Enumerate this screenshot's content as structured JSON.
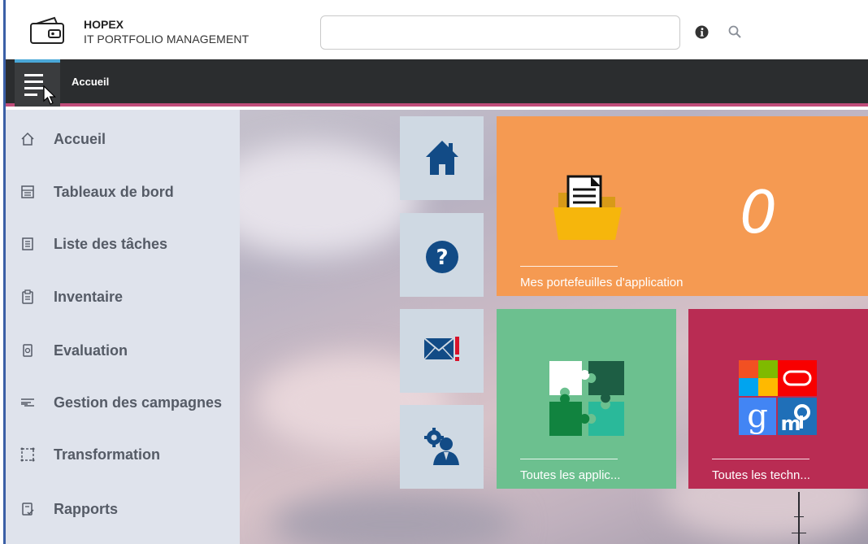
{
  "header": {
    "brand_title": "HOPEX",
    "brand_subtitle": "IT PORTFOLIO MANAGEMENT",
    "search_value": "",
    "icons": {
      "info": "info-icon",
      "search": "search-icon"
    }
  },
  "menubar": {
    "title": "Accueil",
    "menu_icon": "hamburger-menu-icon"
  },
  "sidebar": {
    "items": [
      {
        "label": "Accueil",
        "icon": "home-outline-icon"
      },
      {
        "label": "Tableaux de bord",
        "icon": "dashboard-icon"
      },
      {
        "label": "Liste des tâches",
        "icon": "task-list-icon"
      },
      {
        "label": "Inventaire",
        "icon": "clipboard-icon"
      },
      {
        "label": "Evaluation",
        "icon": "evaluation-icon"
      },
      {
        "label": "Gestion des campagnes",
        "icon": "campaign-icon"
      },
      {
        "label": "Transformation",
        "icon": "transformation-icon"
      },
      {
        "label": "Rapports",
        "icon": "report-icon"
      }
    ]
  },
  "tiles": {
    "home": {
      "icon": "home-icon"
    },
    "help": {
      "icon": "help-icon"
    },
    "mail": {
      "icon": "mail-alert-icon"
    },
    "admin": {
      "icon": "user-settings-icon"
    },
    "portfolios": {
      "label": "Mes portefeuilles d'application",
      "value": "0",
      "icon": "folder-document-icon"
    },
    "applications": {
      "label": "Toutes les applic...",
      "icon": "puzzle-icon"
    },
    "technologies": {
      "label": "Toutes les techn...",
      "icon": "technology-logos-icon"
    }
  },
  "colors": {
    "menubar": "#2b2d2f",
    "accent_line": "#c04c7a",
    "sidebar": "#dfe3ec",
    "tile_orange": "#f59a52",
    "tile_green": "#6cc08f",
    "tile_crimson": "#b92c53",
    "tile_small": "#cfd9e3",
    "icon_blue": "#124b86"
  }
}
